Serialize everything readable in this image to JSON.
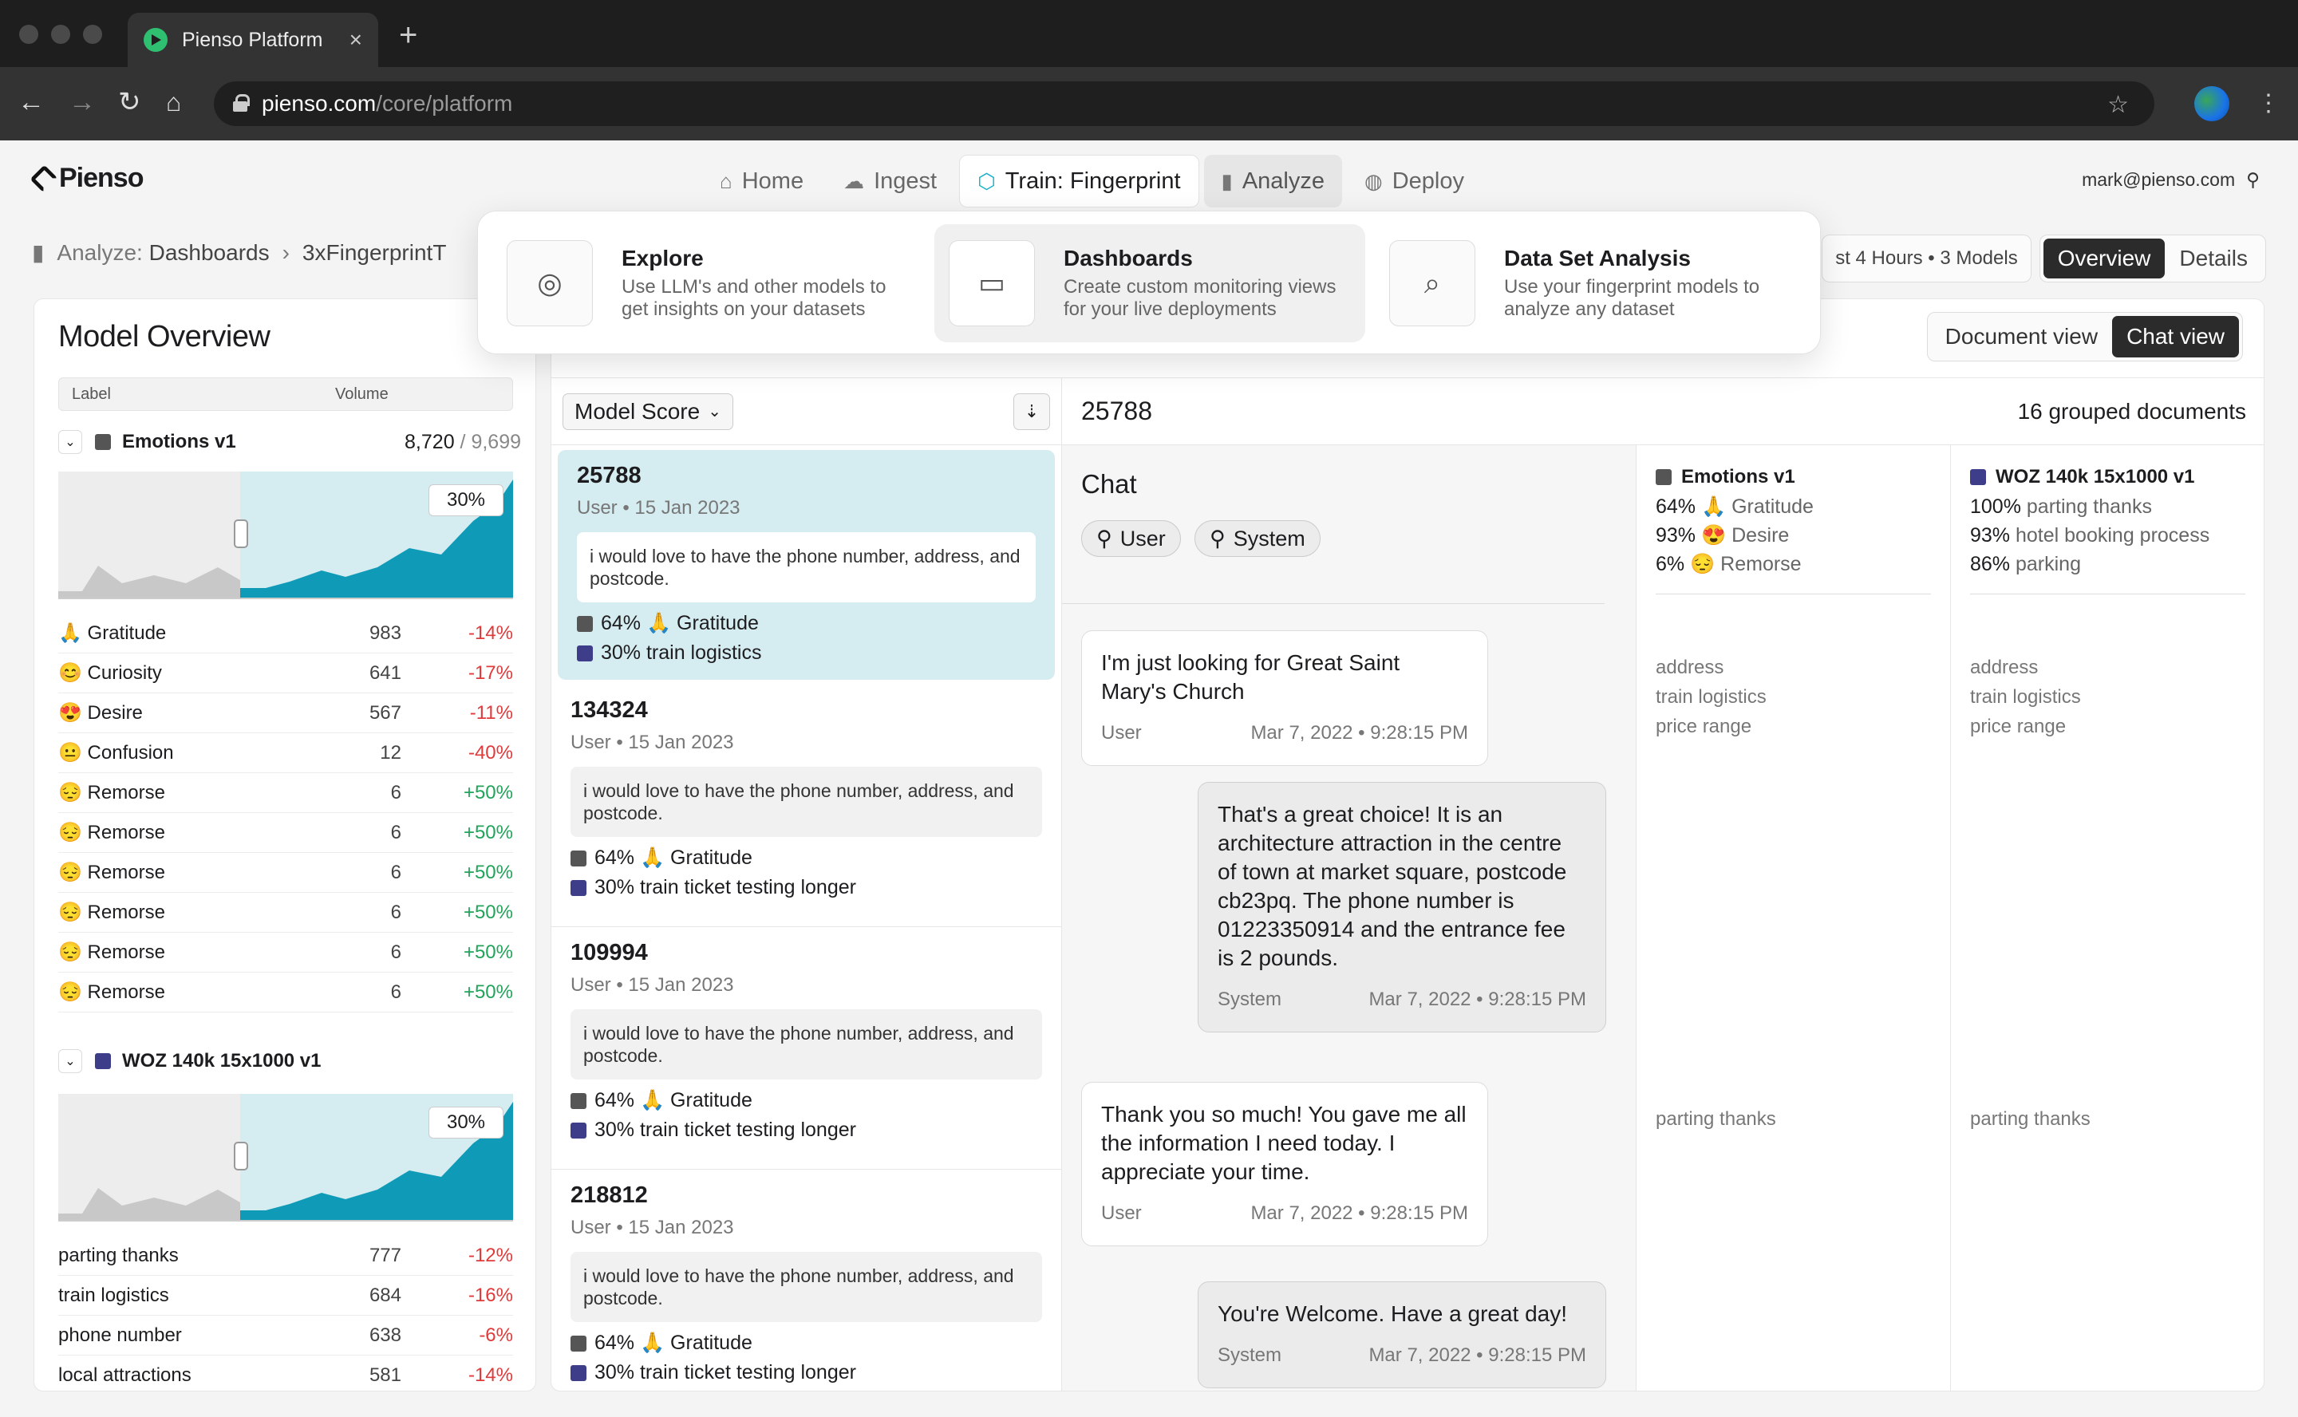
{
  "browser": {
    "tab_title": "Pienso Platform",
    "url_host": "pienso.com",
    "url_path": "/core/platform"
  },
  "app": {
    "brand": "Pienso",
    "user_email": "mark@pienso.com"
  },
  "nav": {
    "home": "Home",
    "ingest": "Ingest",
    "train": "Train: Fingerprint",
    "analyze": "Analyze",
    "deploy": "Deploy"
  },
  "breadcrumb": {
    "section_prefix": "Analyze:",
    "section": "Dashboards",
    "current": "3xFingerprintT"
  },
  "header_right": {
    "timeframe": "st 4 Hours • 3 Models",
    "overview": "Overview",
    "details": "Details"
  },
  "dropdown": [
    {
      "title": "Explore",
      "subtitle": "Use LLM's and other models to get insights on your datasets"
    },
    {
      "title": "Dashboards",
      "subtitle": "Create custom monitoring views for your live deployments"
    },
    {
      "title": "Data Set Analysis",
      "subtitle": "Use your fingerprint models to analyze any dataset"
    }
  ],
  "overview": {
    "title": "Model Overview",
    "col_label": "Label",
    "col_volume": "Volume",
    "models": [
      {
        "name": "Emotions v1",
        "count": "8,720",
        "total": "/ 9,699",
        "pct": "30%",
        "rows": [
          {
            "label": "🙏 Gratitude",
            "value": "983",
            "delta": "-14%"
          },
          {
            "label": "😊 Curiosity",
            "value": "641",
            "delta": "-17%"
          },
          {
            "label": "😍 Desire",
            "value": "567",
            "delta": "-11%"
          },
          {
            "label": "😐 Confusion",
            "value": "12",
            "delta": "-40%"
          },
          {
            "label": "😔 Remorse",
            "value": "6",
            "delta": "+50%"
          },
          {
            "label": "😔 Remorse",
            "value": "6",
            "delta": "+50%"
          },
          {
            "label": "😔 Remorse",
            "value": "6",
            "delta": "+50%"
          },
          {
            "label": "😔 Remorse",
            "value": "6",
            "delta": "+50%"
          },
          {
            "label": "😔 Remorse",
            "value": "6",
            "delta": "+50%"
          },
          {
            "label": "😔 Remorse",
            "value": "6",
            "delta": "+50%"
          }
        ]
      },
      {
        "name": "WOZ 140k 15x1000 v1",
        "pct": "30%",
        "rows": [
          {
            "label": "parting thanks",
            "value": "777",
            "delta": "-12%"
          },
          {
            "label": "train logistics",
            "value": "684",
            "delta": "-16%"
          },
          {
            "label": "phone number",
            "value": "638",
            "delta": "-6%"
          },
          {
            "label": "local attractions",
            "value": "581",
            "delta": "-14%"
          }
        ]
      }
    ]
  },
  "view_toggle": {
    "document": "Document view",
    "chat": "Chat view"
  },
  "list": {
    "sort_label": "Model Score",
    "items": [
      {
        "id": "25788",
        "meta": "User • 15 Jan 2023",
        "snippet": "i would love to have the phone number, address, and postcode.",
        "tag1": "64% 🙏 Gratitude",
        "tag2": "30% train logistics"
      },
      {
        "id": "134324",
        "meta": "User • 15 Jan 2023",
        "snippet": "i would love to have the phone number, address, and postcode.",
        "tag1": "64% 🙏 Gratitude",
        "tag2": "30% train ticket testing longer"
      },
      {
        "id": "109994",
        "meta": "User • 15 Jan 2023",
        "snippet": "i would love to have the phone number, address, and postcode.",
        "tag1": "64% 🙏 Gratitude",
        "tag2": "30% train ticket testing longer"
      },
      {
        "id": "218812",
        "meta": "User • 15 Jan 2023",
        "snippet": "i would love to have the phone number, address, and postcode.",
        "tag1": "64% 🙏 Gratitude",
        "tag2": "30% train ticket testing longer"
      }
    ]
  },
  "detail": {
    "id": "25788",
    "grouped": "16 grouped documents",
    "chat_title": "Chat",
    "pill_user": "User",
    "pill_system": "System",
    "messages": [
      {
        "text": "I'm just looking for Great Saint Mary's Church",
        "who": "User",
        "time": "Mar 7, 2022 • 9:28:15 PM"
      },
      {
        "text": "That's a great choice! It is an architecture attraction in the centre of town at market square, postcode cb23pq. The phone number is 01223350914 and the entrance fee is 2 pounds.",
        "who": "System",
        "time": "Mar 7, 2022 • 9:28:15 PM"
      },
      {
        "text": "Thank you so much! You gave me all the information I need today. I appreciate your time.",
        "who": "User",
        "time": "Mar 7, 2022 • 9:28:15 PM"
      },
      {
        "text": "You're Welcome. Have a great day!",
        "who": "System",
        "time": "Mar 7, 2022 • 9:28:15 PM"
      }
    ],
    "emotions": {
      "name": "Emotions v1",
      "l1p": "64%",
      "l1": "🙏 Gratitude",
      "l2p": "93%",
      "l2": "😍 Desire",
      "l3p": "6%",
      "l3": "😔 Remorse",
      "g1": "address",
      "g2": "train logistics",
      "g3": "price range",
      "g4": "parting thanks"
    },
    "woz": {
      "name": "WOZ 140k 15x1000 v1",
      "l1p": "100%",
      "l1": "parting thanks",
      "l2p": "93%",
      "l2": "hotel booking process",
      "l3p": "86%",
      "l3": "parking",
      "g1": "address",
      "g2": "train logistics",
      "g3": "price range",
      "g4": "parting thanks"
    }
  }
}
